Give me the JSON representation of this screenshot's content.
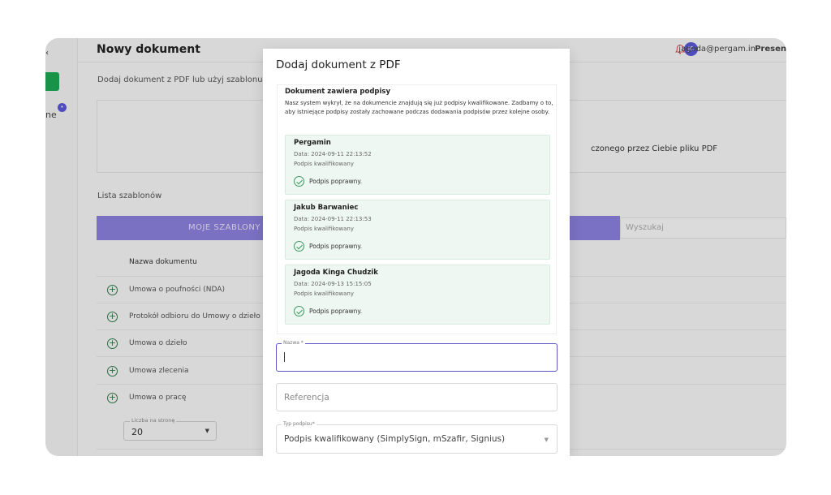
{
  "sidebar": {
    "top_fragment": "‹",
    "fragment": "ne",
    "badge": "•"
  },
  "header": {
    "title": "Nowy dokument",
    "avatar_initials": "JC",
    "user_email": "jagoda@pergam.in",
    "present_label": "Presen"
  },
  "main": {
    "subtitle": "Dodaj dokument z PDF lub użyj szablonu",
    "upload_text": "czonego przez Ciebie pliku PDF",
    "templates_heading": "Lista szablonów",
    "tab_my_templates": "MOJE SZABLONY",
    "search_placeholder": "Wyszukaj",
    "column_header": "Nazwa dokumentu",
    "templates": [
      {
        "name": "Umowa o poufności (NDA)"
      },
      {
        "name": "Protokół odbioru do Umowy o dzieło"
      },
      {
        "name": "Umowa o dzieło"
      },
      {
        "name": "Umowa zlecenia"
      },
      {
        "name": "Umowa o pracę"
      }
    ],
    "per_page_label": "Liczba na stronę",
    "per_page_value": "20"
  },
  "modal": {
    "title": "Dodaj dokument z PDF",
    "signatures_heading": "Dokument zawiera podpisy",
    "signatures_description": "Nasz system wykrył, że na dokumencie znajdują się już podpisy kwalifikowane. Zadbamy o to, aby istniejące podpisy zostały zachowane podczas dodawania podpisów przez kolejne osoby.",
    "signatures": [
      {
        "name": "Pergamin",
        "date": "Data: 2024-09-11 22:13:52",
        "type": "Podpis kwalifikowany",
        "status": "Podpis poprawny."
      },
      {
        "name": "Jakub Barwaniec",
        "date": "Data: 2024-09-11 22:13:53",
        "type": "Podpis kwalifikowany",
        "status": "Podpis poprawny."
      },
      {
        "name": "Jagoda Kinga Chudzik",
        "date": "Data: 2024-09-13 15:15:05",
        "type": "Podpis kwalifikowany",
        "status": "Podpis poprawny."
      }
    ],
    "name_field_label": "Nazwa *",
    "name_field_value": "",
    "reference_placeholder": "Referencja",
    "signature_type_label": "Typ podpisu*",
    "signature_type_value": "Podpis kwalifikowany (SimplySign, mSzafir, Signius)"
  },
  "colors": {
    "accent": "#5b57d9",
    "success": "#3a9a5c",
    "brand_green": "#1ca853"
  }
}
